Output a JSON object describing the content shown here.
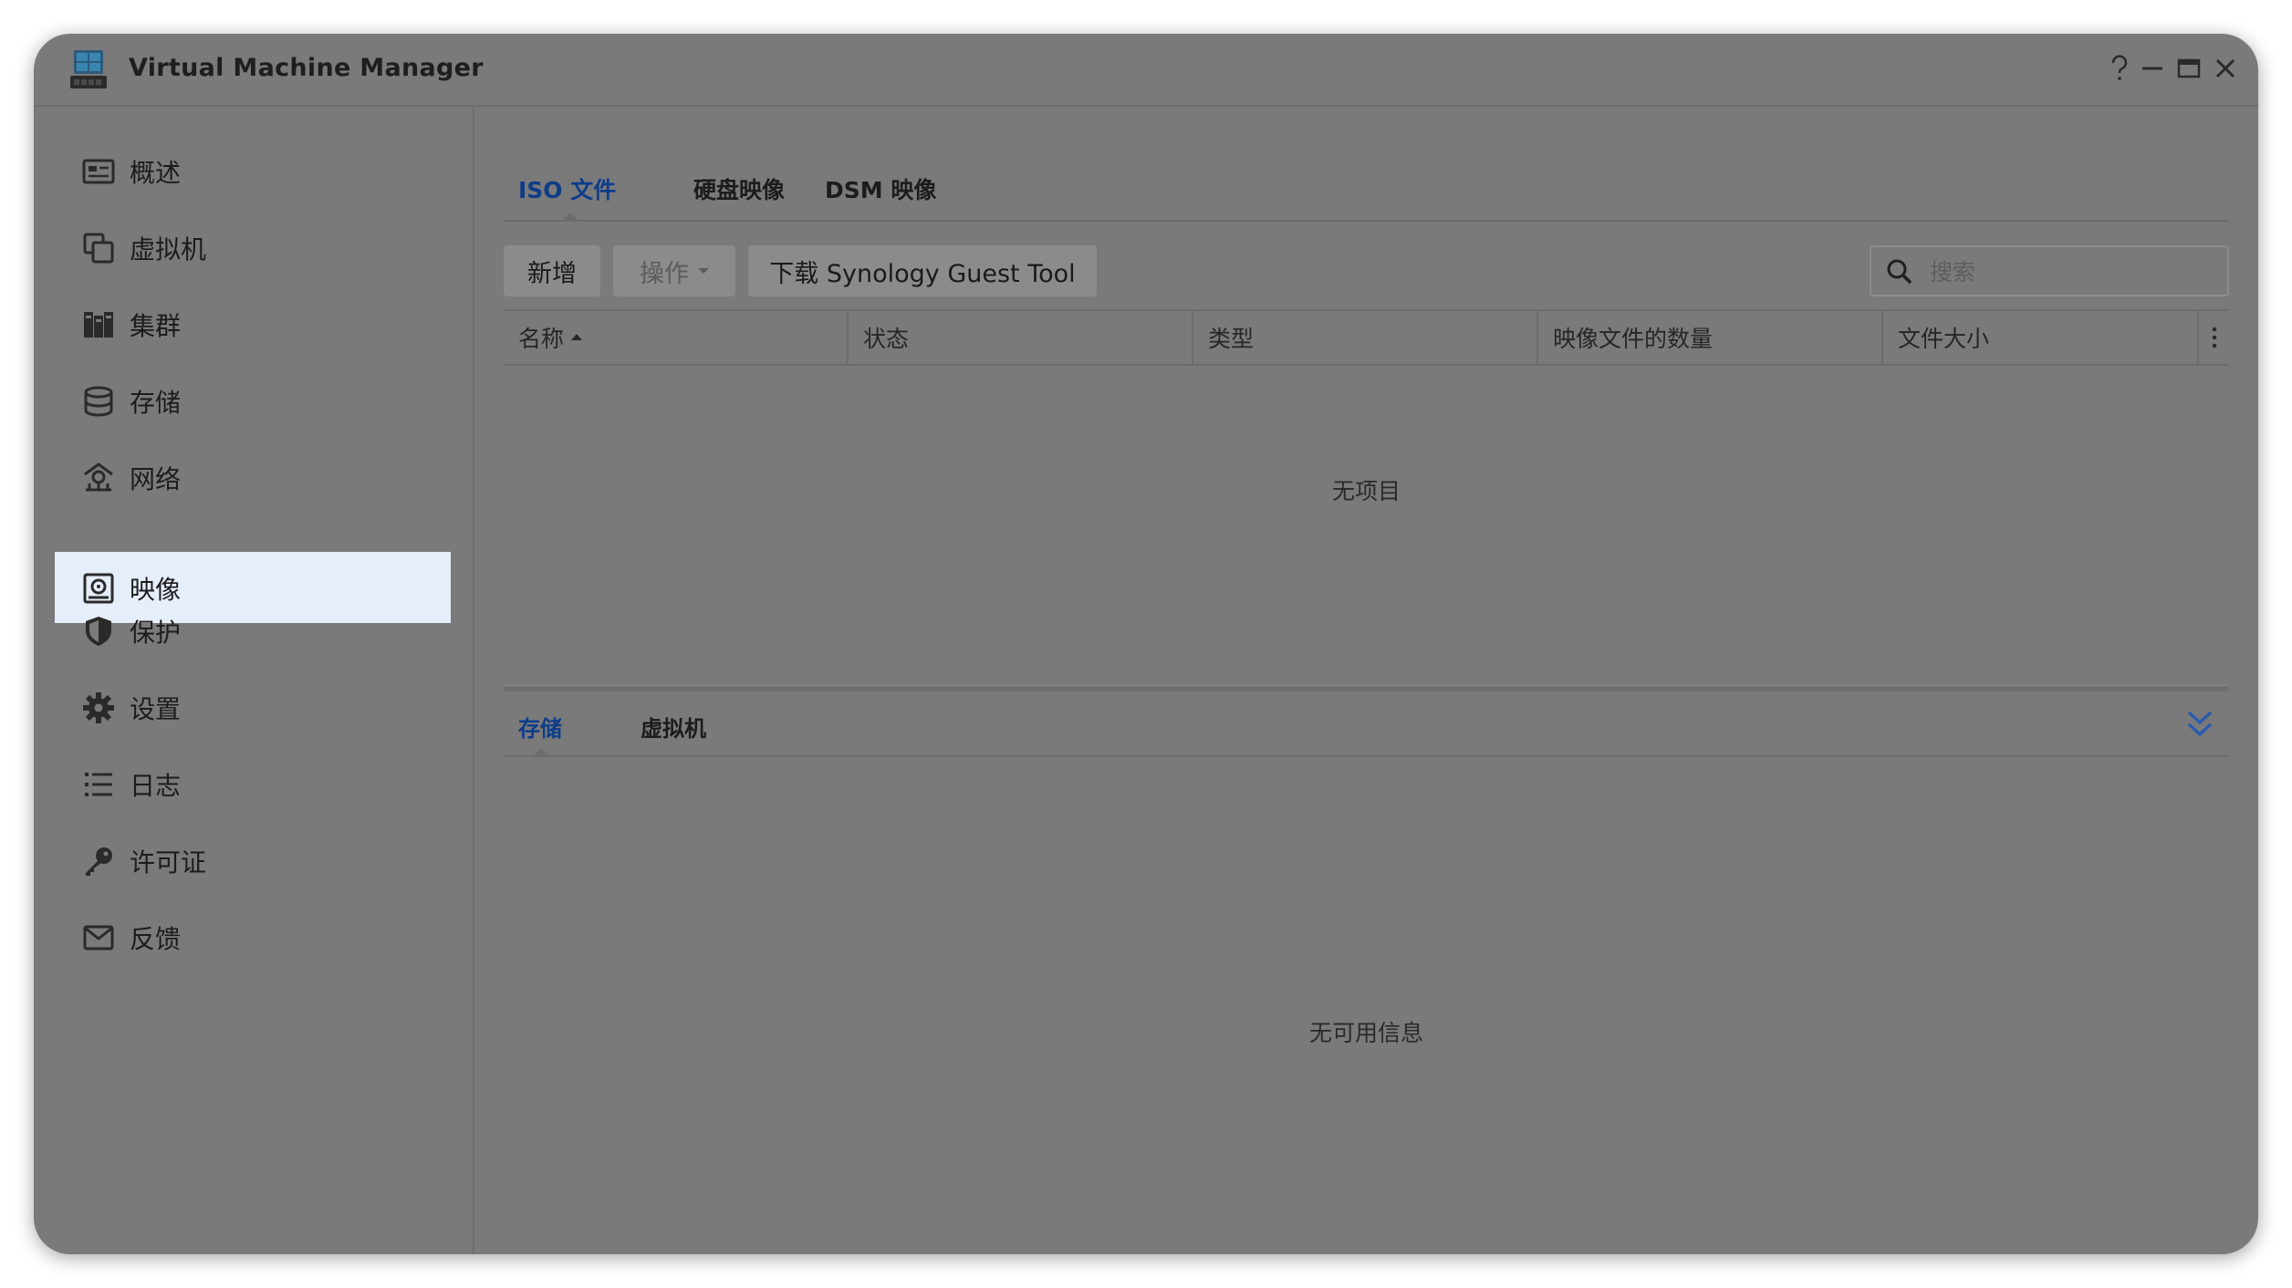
{
  "window": {
    "title": "Virtual Machine Manager",
    "controls": [
      "?",
      "–",
      "□",
      "✕"
    ]
  },
  "sidebar": {
    "items": [
      {
        "label": "概述",
        "icon": "overview-icon"
      },
      {
        "label": "虚拟机",
        "icon": "vm-icon"
      },
      {
        "label": "集群",
        "icon": "cluster-icon"
      },
      {
        "label": "存储",
        "icon": "storage-icon"
      },
      {
        "label": "网络",
        "icon": "network-icon"
      },
      {
        "label": "映像",
        "icon": "image-icon",
        "active": true
      },
      {
        "label": "保护",
        "icon": "shield-icon"
      },
      {
        "label": "设置",
        "icon": "gear-icon"
      },
      {
        "label": "日志",
        "icon": "log-list-icon"
      },
      {
        "label": "许可证",
        "icon": "key-icon"
      },
      {
        "label": "反馈",
        "icon": "mail-icon"
      }
    ]
  },
  "tabs": [
    {
      "label": "ISO 文件",
      "active": true
    },
    {
      "label": "硬盘映像"
    },
    {
      "label": "DSM 映像"
    }
  ],
  "toolbar": {
    "add_label": "新增",
    "action_label": "操作",
    "download_label": "下载 Synology Guest Tool",
    "search_placeholder": "搜索"
  },
  "table": {
    "columns": [
      "名称",
      "状态",
      "类型",
      "映像文件的数量",
      "文件大小"
    ],
    "sort_column": "名称",
    "empty_text": "无项目"
  },
  "detail": {
    "tabs": [
      {
        "label": "存储",
        "active": true
      },
      {
        "label": "虚拟机"
      }
    ],
    "empty_text": "无可用信息"
  },
  "colors": {
    "active_tab": "#0e3c8a",
    "active_nav_bg": "#e6eefb",
    "overlay_bg": "#7a7a7a",
    "collapse_icon": "#2a5bb0"
  }
}
